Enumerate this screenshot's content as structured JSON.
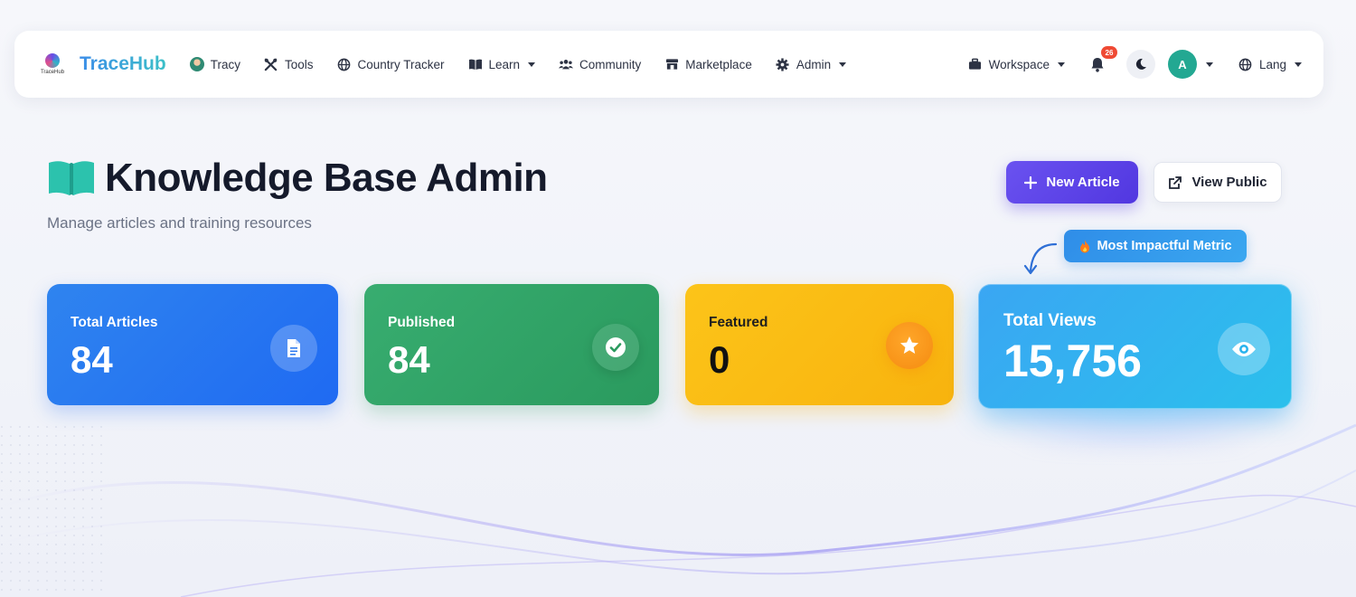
{
  "brand": {
    "name": "TraceHub",
    "logo_text": "TraceHub"
  },
  "nav": {
    "items": [
      {
        "label": "Tracy",
        "icon": "user-avatar-icon"
      },
      {
        "label": "Tools",
        "icon": "tools-icon"
      },
      {
        "label": "Country Tracker",
        "icon": "globe-icon"
      },
      {
        "label": "Learn",
        "icon": "book-icon",
        "dropdown": true
      },
      {
        "label": "Community",
        "icon": "users-icon"
      },
      {
        "label": "Marketplace",
        "icon": "store-icon"
      },
      {
        "label": "Admin",
        "icon": "gear-icon",
        "dropdown": true
      }
    ],
    "right": {
      "workspace_label": "Workspace",
      "notifications_count": "26",
      "user_initial": "A",
      "lang_label": "Lang"
    }
  },
  "header": {
    "title": "Knowledge Base Admin",
    "subtitle": "Manage articles and training resources",
    "new_article_label": "New Article",
    "view_public_label": "View Public",
    "impact_badge": "Most Impactful Metric"
  },
  "stats": [
    {
      "label": "Total Articles",
      "value": "84",
      "icon": "document-icon",
      "color": "#1f6af2"
    },
    {
      "label": "Published",
      "value": "84",
      "icon": "check-circle-icon",
      "color": "#2a9a5e"
    },
    {
      "label": "Featured",
      "value": "0",
      "icon": "star-icon",
      "color": "#f8b30e"
    },
    {
      "label": "Total Views",
      "value": "15,756",
      "icon": "eye-icon",
      "color": "#2bb4ee"
    }
  ],
  "colors": {
    "accent": "#5a40e6",
    "badge": "#ef4a34",
    "avatar": "#23a892"
  }
}
